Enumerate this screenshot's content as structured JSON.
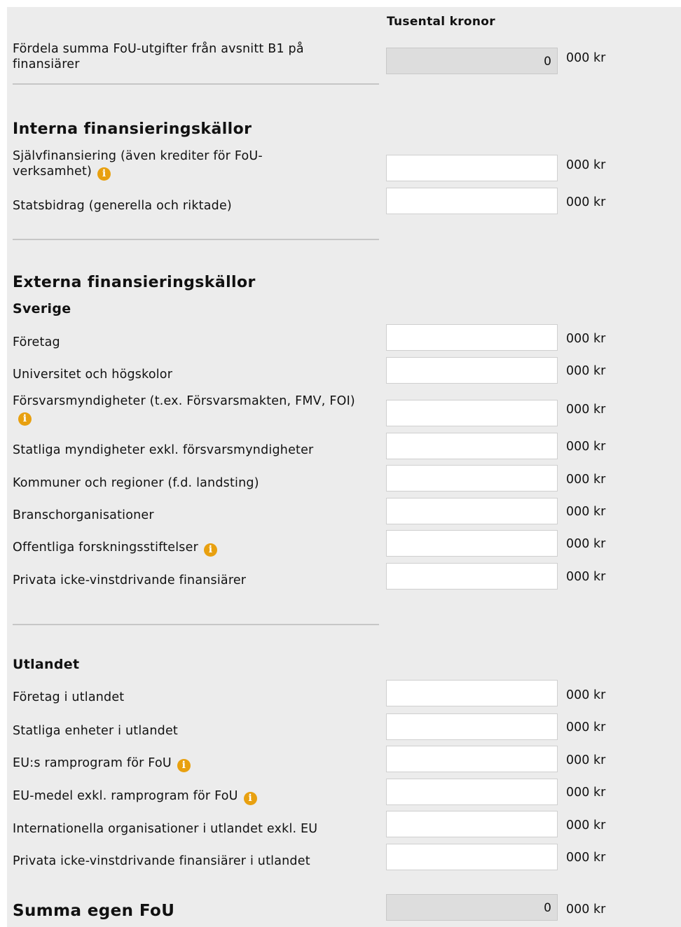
{
  "header": {
    "column_title": "Tusental kronor"
  },
  "unit_label": "000 kr",
  "info_glyph": "i",
  "distribute": {
    "label": "Fördela summa FoU-utgifter från avsnitt B1 på finansiärer",
    "value": "0"
  },
  "internal": {
    "title": "Interna finansieringskällor",
    "rows": [
      {
        "label": "Självfinansiering (även krediter för FoU-verksamhet)",
        "value": "",
        "info": true
      },
      {
        "label": "Statsbidrag (generella och riktade)",
        "value": "",
        "info": false
      }
    ]
  },
  "external": {
    "title": "Externa finansieringskällor",
    "sweden": {
      "title": "Sverige",
      "rows": [
        {
          "label": "Företag",
          "value": ""
        },
        {
          "label": "Universitet och högskolor",
          "value": ""
        },
        {
          "label": "Försvarsmyndigheter (t.ex. Försvarsmakten, FMV, FOI)",
          "value": "",
          "info": true
        },
        {
          "label": "Statliga myndigheter exkl. försvarsmyndigheter",
          "value": ""
        },
        {
          "label": "Kommuner och regioner (f.d. landsting)",
          "value": ""
        },
        {
          "label": "Branschorganisationer",
          "value": ""
        },
        {
          "label": "Offentliga forskningsstiftelser",
          "value": "",
          "info": true
        },
        {
          "label": "Privata icke-vinstdrivande finansiärer",
          "value": ""
        }
      ]
    },
    "abroad": {
      "title": "Utlandet",
      "rows": [
        {
          "label": "Företag i utlandet",
          "value": ""
        },
        {
          "label": "Statliga enheter i utlandet",
          "value": ""
        },
        {
          "label": "EU:s ramprogram för FoU",
          "value": "",
          "info": true
        },
        {
          "label": "EU-medel exkl. ramprogram för FoU",
          "value": "",
          "info": true
        },
        {
          "label": "Internationella organisationer i utlandet exkl. EU",
          "value": ""
        },
        {
          "label": "Privata icke-vinstdrivande finansiärer i utlandet",
          "value": ""
        }
      ]
    }
  },
  "total": {
    "label": "Summa egen FoU",
    "value": "0"
  },
  "colors": {
    "info_icon": "#e8a00f",
    "panel_bg": "#ececec",
    "readonly_bg": "#dddddd"
  }
}
